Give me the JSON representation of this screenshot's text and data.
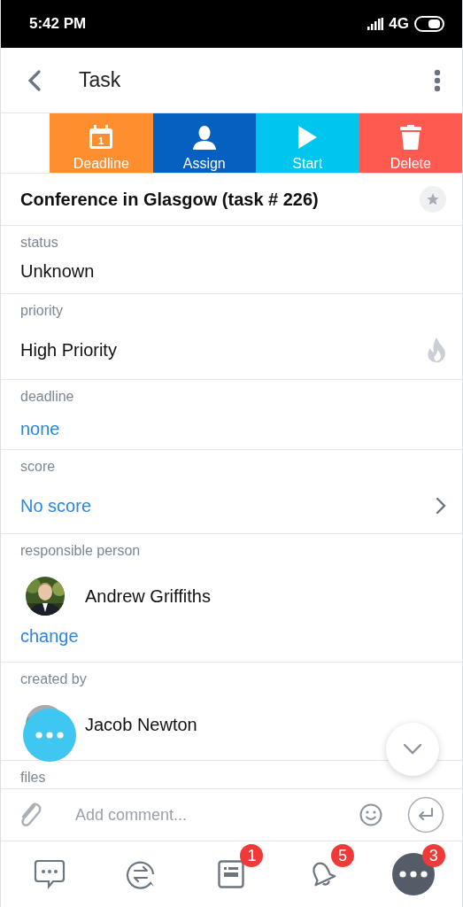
{
  "status_bar": {
    "time": "5:42 PM",
    "network": "4G"
  },
  "header": {
    "title": "Task"
  },
  "actions": [
    {
      "kind": "deadline",
      "label": "Deadline",
      "color": "#ff8f2e",
      "icon_text": "1"
    },
    {
      "kind": "assign",
      "label": "Assign",
      "color": "#0560c0"
    },
    {
      "kind": "start",
      "label": "Start",
      "color": "#00c6ef"
    },
    {
      "kind": "delete",
      "label": "Delete",
      "color": "#ff5a4f"
    }
  ],
  "task": {
    "title": "Conference in Glasgow (task # 226)",
    "starred": false
  },
  "fields": [
    {
      "kind": "text",
      "label": "status",
      "value": "Unknown"
    },
    {
      "kind": "priority",
      "label": "priority",
      "value": "High Priority"
    },
    {
      "kind": "link",
      "label": "deadline",
      "value": "none"
    },
    {
      "kind": "link_more",
      "label": "score",
      "value": "No score"
    },
    {
      "kind": "person",
      "label": "responsible person",
      "value": "Andrew Griffiths",
      "action": "change"
    },
    {
      "kind": "person",
      "label": "created by",
      "value": "Jacob Newton"
    },
    {
      "kind": "label_only",
      "label": "files"
    }
  ],
  "comment": {
    "placeholder": "Add comment..."
  },
  "nav": [
    {
      "kind": "chat",
      "selected": false
    },
    {
      "kind": "exchange",
      "selected": false
    },
    {
      "kind": "tasks",
      "badge": "1",
      "selected": false
    },
    {
      "kind": "bell",
      "badge": "5",
      "selected": false
    },
    {
      "kind": "more",
      "badge": "3",
      "selected": true
    }
  ]
}
